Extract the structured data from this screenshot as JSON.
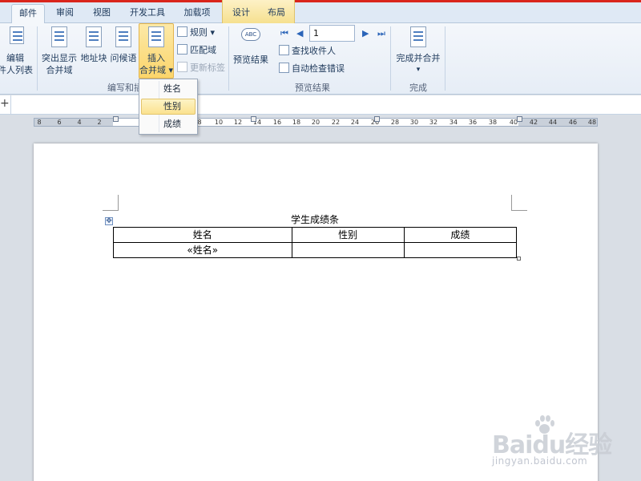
{
  "tabs": [
    "邮件",
    "审阅",
    "视图",
    "开发工具",
    "加载项"
  ],
  "context_tabs": [
    "设计",
    "布局"
  ],
  "ribbon": {
    "left_partial": {
      "line1": "编辑",
      "line2": "件人列表"
    },
    "big_buttons": [
      {
        "line1": "突出显示",
        "line2": "合并域"
      },
      {
        "line1": "地址块",
        "line2": ""
      },
      {
        "line1": "问候语",
        "line2": ""
      },
      {
        "line1": "插入",
        "line2": "合并域 ▾"
      }
    ],
    "small_buttons": [
      {
        "label": "规则 ▾",
        "disabled": false
      },
      {
        "label": "匹配域",
        "disabled": false
      },
      {
        "label": "更新标签",
        "disabled": true
      }
    ],
    "group_labels": [
      "编写和插",
      "预览结果",
      "完成"
    ],
    "preview_button": "预览结果",
    "record_value": "1",
    "find_recipient": "查找收件人",
    "auto_check": "自动检查错误",
    "finish_button": {
      "line1": "完成并合并",
      "line2": "▾"
    }
  },
  "dropdown": {
    "items": [
      "姓名",
      "性别",
      "成绩"
    ],
    "hover_index": 1
  },
  "ruler": {
    "numbers": [
      "8",
      "6",
      "4",
      "2",
      "2",
      "4",
      "6",
      "8",
      "10",
      "12",
      "14",
      "16",
      "18",
      "20",
      "22",
      "24",
      "26",
      "28",
      "30",
      "32",
      "34",
      "36",
      "38",
      "40",
      "42",
      "44",
      "46",
      "48"
    ]
  },
  "document": {
    "title": "学生成绩条",
    "table": {
      "headers": [
        "姓名",
        "性别",
        "成绩"
      ],
      "row": [
        "«姓名»",
        "",
        ""
      ]
    }
  },
  "watermark": {
    "brand": "Baidu经验",
    "url": "jingyan.baidu.com"
  }
}
